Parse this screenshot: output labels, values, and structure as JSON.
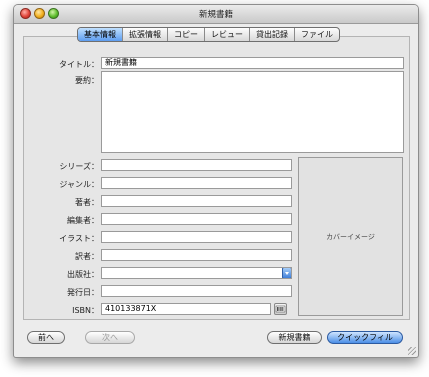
{
  "window": {
    "title": "新規書籍"
  },
  "tabs": [
    {
      "label": "基本情報",
      "active": true
    },
    {
      "label": "拡張情報",
      "active": false
    },
    {
      "label": "コピー",
      "active": false
    },
    {
      "label": "レビュー",
      "active": false
    },
    {
      "label": "貸出記録",
      "active": false
    },
    {
      "label": "ファイル",
      "active": false
    }
  ],
  "form": {
    "title_label": "タイトル：",
    "title_value": "新規書籍",
    "summary_label": "要約：",
    "summary_value": "",
    "series_label": "シリーズ：",
    "genre_label": "ジャンル：",
    "author_label": "著者：",
    "editor_label": "編集者：",
    "illustrator_label": "イラスト：",
    "translator_label": "訳者：",
    "publisher_label": "出版社：",
    "pubdate_label": "発行日：",
    "isbn_label": "ISBN：",
    "isbn_value": "410133871X"
  },
  "cover": {
    "label": "カバーイメージ"
  },
  "buttons": {
    "prev": "前へ",
    "next": "次へ",
    "new_book": "新規書籍",
    "quick_fill": "クイックフィル"
  },
  "colors": {
    "accent": "#5d9df0",
    "primary_button": "#4b8ee6"
  },
  "icons": {
    "barcode": "barcode-scanner-icon"
  }
}
